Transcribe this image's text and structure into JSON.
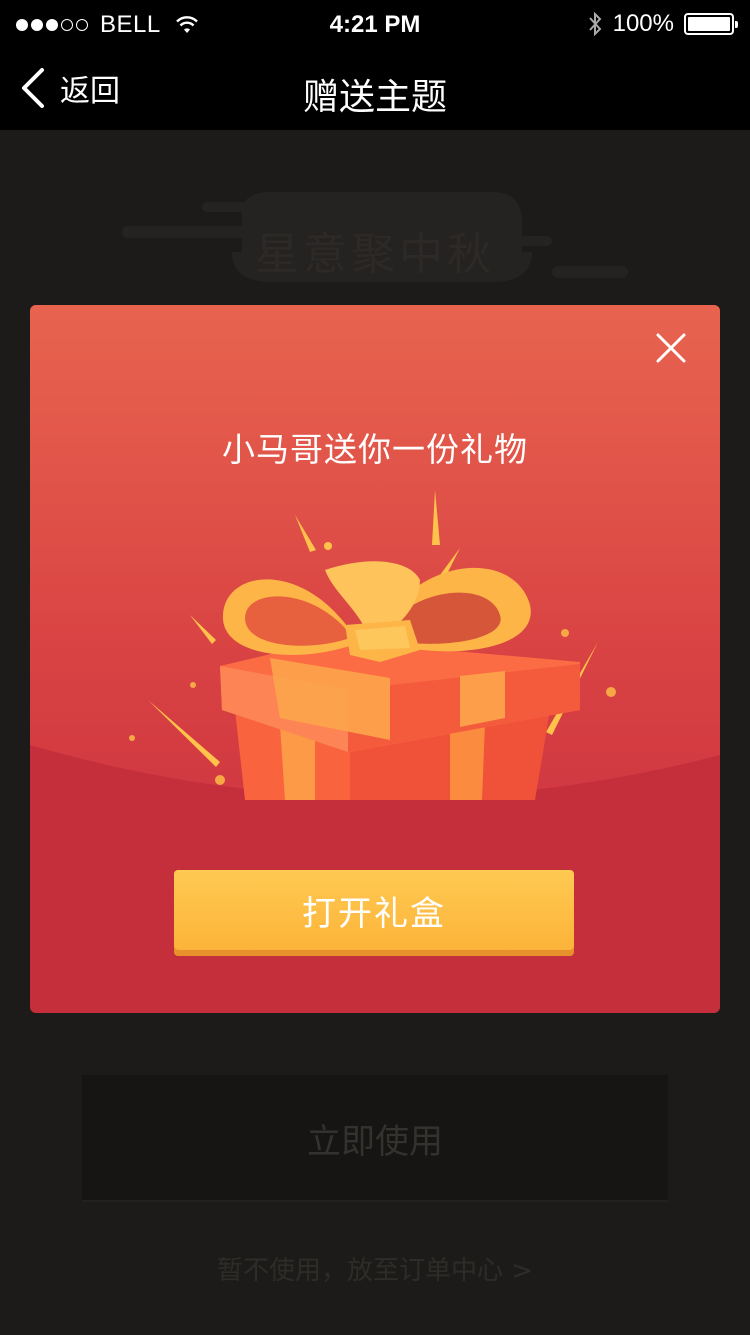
{
  "status_bar": {
    "carrier": "BELL",
    "time": "4:21 PM",
    "battery": "100%",
    "signal_bars_filled": 3,
    "signal_bars_total": 5
  },
  "nav": {
    "back_label": "返回",
    "title": "赠送主题"
  },
  "background_page": {
    "banner_text": "星意聚中秋",
    "use_button_label": "立即使用",
    "later_link": "暂不使用，放至订单中心 >"
  },
  "modal": {
    "title": "小马哥送你一份礼物",
    "open_button_label": "打开礼盒",
    "colors": {
      "gradient_top": "#e8644f",
      "gradient_bottom": "#c52e3b",
      "button": "#fcb339"
    }
  }
}
